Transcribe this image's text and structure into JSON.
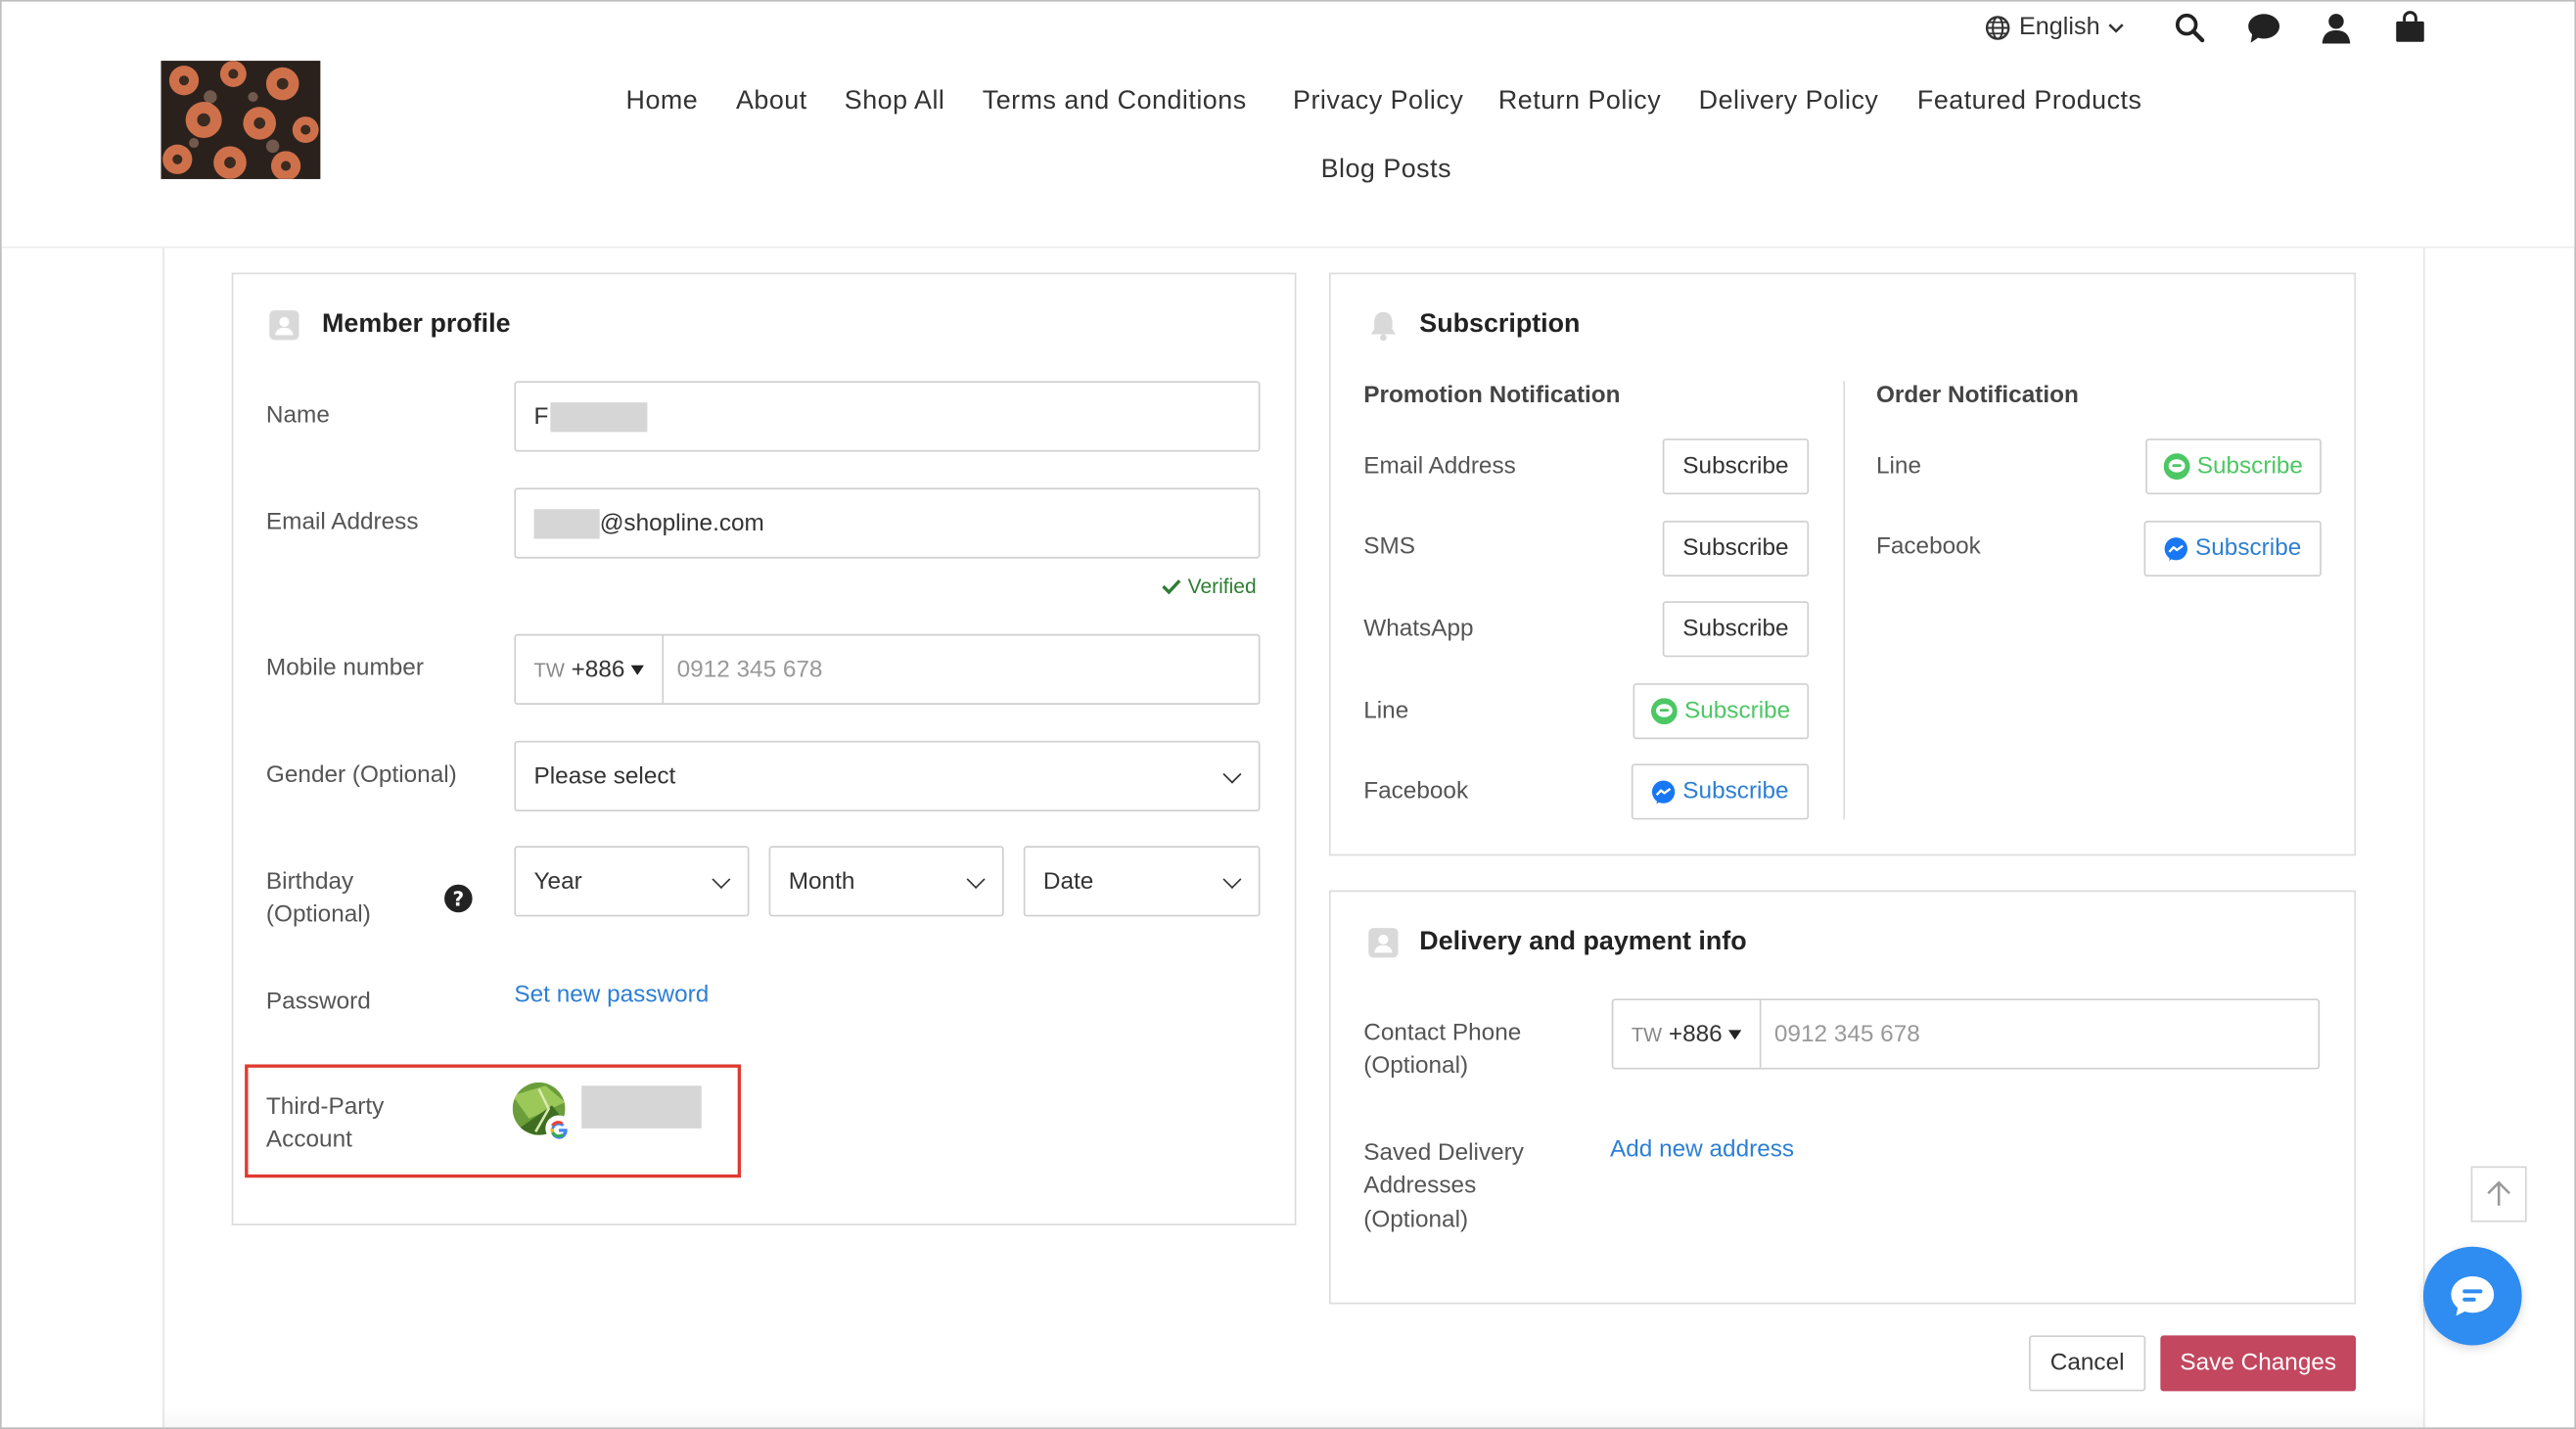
{
  "topbar": {
    "language": "English",
    "icons": [
      "globe-icon",
      "chevron-down-icon",
      "search-icon",
      "chat-icon",
      "user-icon",
      "shopping-bag-icon"
    ]
  },
  "nav": {
    "home": "Home",
    "about": "About",
    "shop_all": "Shop All",
    "terms": "Terms and Conditions",
    "privacy": "Privacy Policy",
    "return": "Return Policy",
    "delivery": "Delivery Policy",
    "featured": "Featured Products",
    "blog": "Blog Posts"
  },
  "member_profile": {
    "title": "Member profile",
    "name_label": "Name",
    "name_value": "F",
    "email_label": "Email Address",
    "email_value": "@shopline.com",
    "verified": "Verified",
    "mobile_label": "Mobile number",
    "mobile_country": "TW",
    "mobile_code": "+886",
    "mobile_placeholder": "0912 345 678",
    "gender_label": "Gender (Optional)",
    "gender_value": "Please select",
    "birthday_label_1": "Birthday",
    "birthday_label_2": "(Optional)",
    "year": "Year",
    "month": "Month",
    "date": "Date",
    "password_label": "Password",
    "password_link": "Set new password",
    "third_party_label_1": "Third-Party",
    "third_party_label_2": "Account"
  },
  "subscription": {
    "title": "Subscription",
    "promotion_title": "Promotion Notification",
    "order_title": "Order Notification",
    "email": "Email Address",
    "sms": "SMS",
    "whatsapp": "WhatsApp",
    "line": "Line",
    "facebook": "Facebook",
    "subscribe": "Subscribe"
  },
  "delivery_payment": {
    "title": "Delivery and payment info",
    "contact_label_1": "Contact Phone",
    "contact_label_2": "(Optional)",
    "contact_country": "TW",
    "contact_code": "+886",
    "contact_placeholder": "0912 345 678",
    "saved_label_1": "Saved Delivery",
    "saved_label_2": "Addresses",
    "saved_label_3": "(Optional)",
    "add_address": "Add new address"
  },
  "actions": {
    "cancel": "Cancel",
    "save": "Save Changes"
  },
  "colors": {
    "link_blue": "#2d7fd3",
    "line_green": "#4cc764",
    "messenger_blue": "#1877f2",
    "save_red": "#c2475f",
    "highlight_red": "#e03a2f",
    "chat_fab_blue": "#2f8cf0",
    "verified_green": "#2e7d32"
  }
}
